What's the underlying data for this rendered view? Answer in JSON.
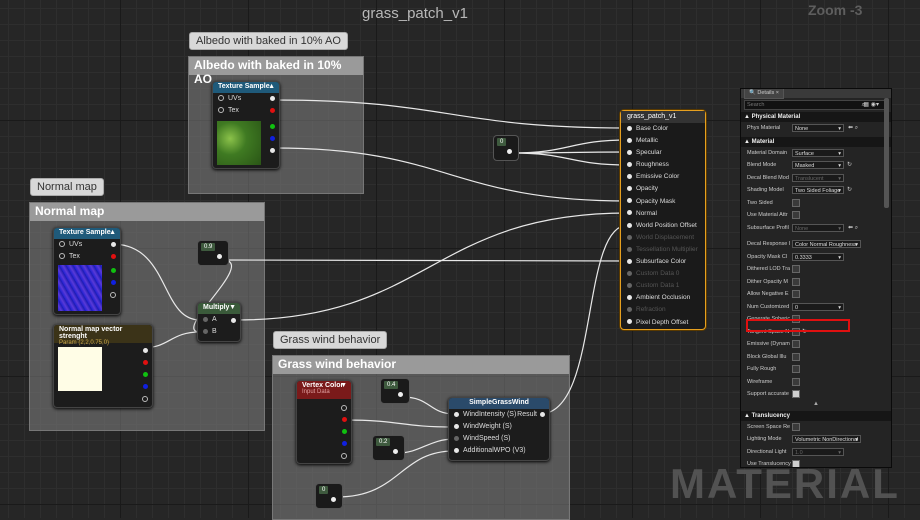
{
  "graph": {
    "title": "grass_patch_v1",
    "zoom": "Zoom -3",
    "watermark": "MATERIAL"
  },
  "comments": {
    "albedo": {
      "bubble": "Albedo with baked in 10% AO",
      "header": "Albedo with baked in 10% AO"
    },
    "normal": {
      "bubble": "Normal map",
      "header": "Normal map"
    },
    "wind": {
      "bubble": "Grass wind behavior",
      "header": "Grass wind behavior"
    }
  },
  "nodes": {
    "albedo_texture": {
      "title": "Texture Sample",
      "pin_uvs": "UVs",
      "pin_tex": "Tex",
      "thumb_color": "#4f8a2a"
    },
    "normal_texture": {
      "title": "Texture Sample",
      "pin_uvs": "UVs",
      "pin_tex": "Tex",
      "thumb_color": "#2a2ac8"
    },
    "vector_param": {
      "title": "Normal map vector strenght",
      "subtitle": "Param (2,2,0.75,0)",
      "swatch_color": "#fffde6"
    },
    "multiply": {
      "title": "Multiply",
      "pin_a": "A",
      "pin_b": "B"
    },
    "vertex_color": {
      "title": "Vertex Color",
      "subtitle": "Input Data"
    },
    "wind_function": {
      "title": "SimpleGrassWind",
      "pins": [
        "WindIntensity (S)",
        "WindWeight (S)",
        "WindSpeed (S)",
        "AdditionalWPO (V3)"
      ],
      "result": "Result"
    },
    "const_metallic": "0",
    "const_normal": "0.9",
    "const_wind_intensity": "0.4",
    "const_wind_speed": "0.2",
    "const_wpo": "0"
  },
  "material_node": {
    "title": "grass_patch_v1",
    "pins": [
      {
        "label": "Base Color",
        "enabled": true
      },
      {
        "label": "Metallic",
        "enabled": true
      },
      {
        "label": "Specular",
        "enabled": true
      },
      {
        "label": "Roughness",
        "enabled": true
      },
      {
        "label": "Emissive Color",
        "enabled": true
      },
      {
        "label": "Opacity",
        "enabled": true
      },
      {
        "label": "Opacity Mask",
        "enabled": true
      },
      {
        "label": "Normal",
        "enabled": true
      },
      {
        "label": "World Position Offset",
        "enabled": true
      },
      {
        "label": "World Displacement",
        "enabled": false
      },
      {
        "label": "Tessellation Multiplier",
        "enabled": false
      },
      {
        "label": "Subsurface Color",
        "enabled": true
      },
      {
        "label": "Custom Data 0",
        "enabled": false
      },
      {
        "label": "Custom Data 1",
        "enabled": false
      },
      {
        "label": "Ambient Occlusion",
        "enabled": true
      },
      {
        "label": "Refraction",
        "enabled": false
      },
      {
        "label": "Pixel Depth Offset",
        "enabled": true
      }
    ]
  },
  "details": {
    "tab": "Details",
    "search_placeholder": "Search",
    "sections": {
      "physical": "Physical Material",
      "material": "Material",
      "translucency": "Translucency"
    },
    "phys_material": {
      "label": "Phys Material",
      "value": "None"
    },
    "material_domain": {
      "label": "Material Domain",
      "value": "Surface"
    },
    "blend_mode": {
      "label": "Blend Mode",
      "value": "Masked"
    },
    "decal_blend": {
      "label": "Decal Blend Mod",
      "value": "Translucent"
    },
    "shading_model": {
      "label": "Shading Model",
      "value": "Two Sided Foliage"
    },
    "two_sided": {
      "label": "Two Sided",
      "checked": false
    },
    "use_material_attr": {
      "label": "Use Material Attr",
      "checked": false
    },
    "subsurface_profile": {
      "label": "Subsurface Profil",
      "value": "None"
    },
    "decal_response": {
      "label": "Decal Response I",
      "value": "Color Normal Roughness"
    },
    "opacity_clip": {
      "label": "Opacity Mask Cl",
      "value": "0.3333"
    },
    "dithered_lod": {
      "label": "Dithered LOD Tra",
      "checked": false
    },
    "dither_opacity": {
      "label": "Dither Opacity M",
      "checked": false
    },
    "allow_negative": {
      "label": "Allow Negative E",
      "checked": false
    },
    "num_customized": {
      "label": "Num Customized",
      "value": "0"
    },
    "generate_spherical": {
      "label": "Generate Spheric",
      "checked": false
    },
    "tangent_space": {
      "label": "Tangent Space N",
      "checked": false
    },
    "emissive_dynamic": {
      "label": "Emissive (Dynam",
      "checked": false
    },
    "block_gi": {
      "label": "Block Global Illu",
      "checked": false
    },
    "fully_rough": {
      "label": "Fully Rough",
      "checked": false
    },
    "wireframe": {
      "label": "Wireframe",
      "checked": false
    },
    "support_accurate": {
      "label": "Support accurate",
      "checked": true
    },
    "screen_space": {
      "label": "Screen Space Re",
      "checked": false
    },
    "lighting_mode": {
      "label": "Lighting Mode",
      "value": "Volumetric NonDirectional"
    },
    "directional_light": {
      "label": "Directional Light",
      "value": "1.0"
    },
    "use_translucency": {
      "label": "Use Translucency",
      "checked": true
    }
  }
}
